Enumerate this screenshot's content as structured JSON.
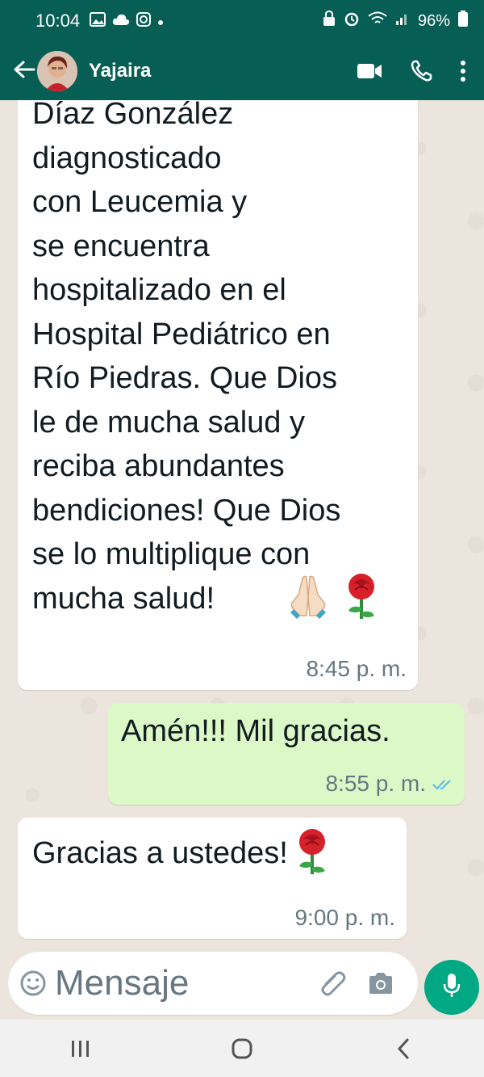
{
  "status_bar": {
    "time": "10:04",
    "battery": "96%",
    "icons": [
      "image-icon",
      "cloud-icon",
      "instagram-icon",
      "dot-icon",
      "lock-icon",
      "alarm-icon",
      "wifi-icon",
      "signal-icon",
      "battery-icon"
    ]
  },
  "header": {
    "contact_name": "Yajaira",
    "accent_color": "#075e54",
    "icons": [
      "back-arrow-icon",
      "video-call-icon",
      "phone-icon",
      "more-options-icon"
    ]
  },
  "messages": [
    {
      "direction": "incoming",
      "text": "Díaz González\ndiagnosticado\ncon Leucemia  y\nse encuentra\nhospitalizado en el\nHospital Pediátrico en\nRío Piedras. Que Dios\nle de mucha salud y\nreciba abundantes\nbendiciones! Que Dios\nse lo multiplique con\nmucha salud!",
      "emojis": [
        "praying-hands",
        "rose"
      ],
      "time": "8:45 p. m."
    },
    {
      "direction": "outgoing",
      "text": "Amén!!! Mil gracias.",
      "time": "8:55 p. m.",
      "status": "read"
    },
    {
      "direction": "incoming",
      "text": "Gracias a ustedes!",
      "emojis": [
        "rose"
      ],
      "time": "9:00 p. m."
    }
  ],
  "composer": {
    "placeholder": "Mensaje",
    "icons": [
      "emoji-icon",
      "attach-icon",
      "camera-icon",
      "mic-icon"
    ]
  },
  "navigation": {
    "icons": [
      "recent-apps-icon",
      "home-icon",
      "back-icon"
    ]
  }
}
